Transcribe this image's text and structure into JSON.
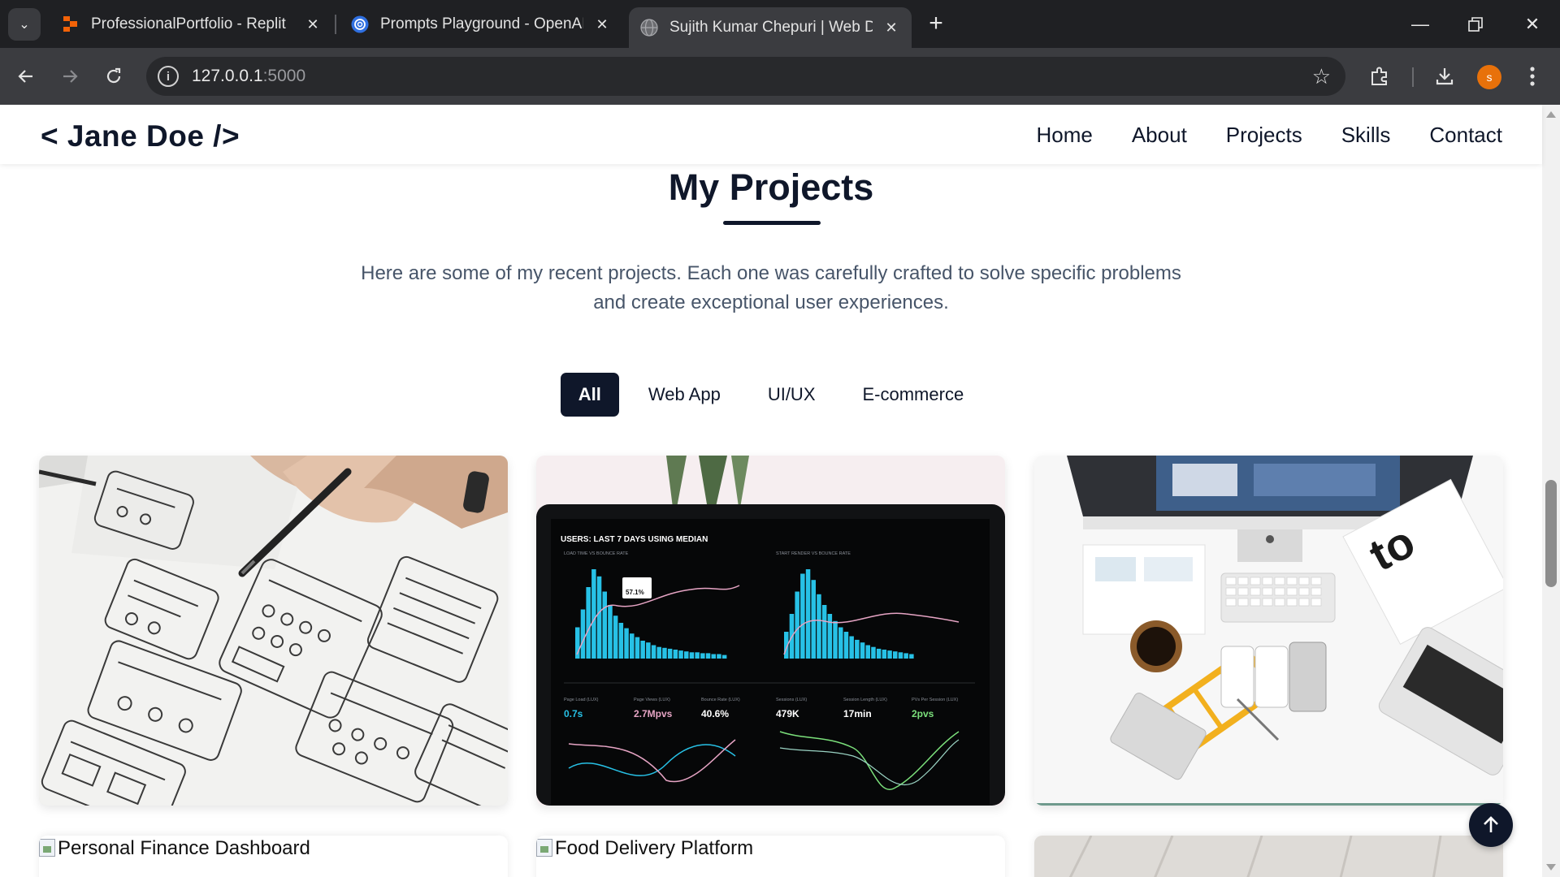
{
  "browser": {
    "tabs": [
      {
        "title": "ProfessionalPortfolio - Replit",
        "icon": "replit-icon",
        "active": false
      },
      {
        "title": "Prompts Playground - OpenAI A",
        "icon": "openai-icon",
        "active": false
      },
      {
        "title": "Sujith Kumar Chepuri | Web Dev",
        "icon": "globe-icon",
        "active": true
      }
    ],
    "url_host": "127.0.0.1",
    "url_port": ":5000",
    "profile_initial": "s"
  },
  "site": {
    "logo": "< Jane Doe />",
    "nav": [
      "Home",
      "About",
      "Projects",
      "Skills",
      "Contact"
    ]
  },
  "projects": {
    "title": "My Projects",
    "description": "Here are some of my recent projects. Each one was carefully crafted to solve specific problems and create exceptional user experiences.",
    "filters": [
      {
        "label": "All",
        "active": true
      },
      {
        "label": "Web App",
        "active": false
      },
      {
        "label": "UI/UX",
        "active": false
      },
      {
        "label": "E-commerce",
        "active": false
      }
    ],
    "row2_alt": [
      "Personal Finance Dashboard",
      "Food Delivery Platform"
    ],
    "dashboard_image": {
      "header": "USERS: LAST 7 DAYS USING MEDIAN",
      "panel_left": "LOAD TIME VS BOUNCE RATE",
      "panel_right": "START RENDER VS BOUNCE RATE",
      "tooltip": "57.1%",
      "stat_labels": [
        "Page Load (LUX)",
        "Page Views (LUX)",
        "Bounce Rate (LUX)",
        "Sessions (LUX)",
        "Session Length (LUX)",
        "PVs Per Session (LUX)"
      ],
      "stat_values": [
        "0.7s",
        "2.7Mpvs",
        "40.6%",
        "479K",
        "17min",
        "2pvs"
      ],
      "bars_left": [
        0.35,
        0.55,
        0.8,
        1.0,
        0.92,
        0.75,
        0.6,
        0.48,
        0.4,
        0.34,
        0.28,
        0.24,
        0.2,
        0.18,
        0.15,
        0.13,
        0.12,
        0.11,
        0.1,
        0.09,
        0.08,
        0.07,
        0.07,
        0.06,
        0.06,
        0.05,
        0.05,
        0.04
      ],
      "bars_right": [
        0.3,
        0.5,
        0.75,
        0.95,
        1.0,
        0.88,
        0.72,
        0.6,
        0.5,
        0.42,
        0.35,
        0.3,
        0.25,
        0.21,
        0.18,
        0.15,
        0.13,
        0.11,
        0.1,
        0.09,
        0.08,
        0.07,
        0.06,
        0.05
      ]
    }
  },
  "colors": {
    "brand": "#0f172a",
    "text_muted": "#475569",
    "chrome_dark": "#1f2023",
    "chrome_toolbar": "#3b3c40"
  }
}
